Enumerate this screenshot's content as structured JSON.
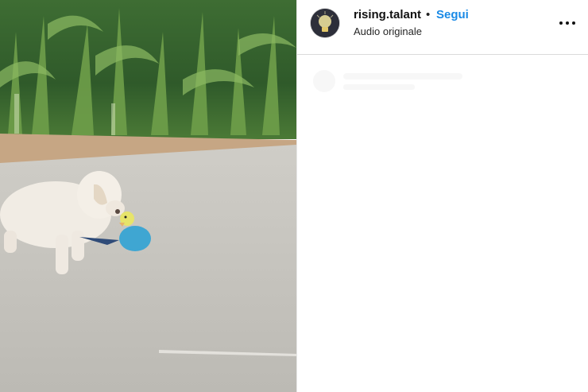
{
  "post": {
    "username": "rising.talant",
    "separator": "•",
    "follow_label": "Segui",
    "audio_label": "Audio originale"
  },
  "icons": {
    "avatar": "lightbulb-avatar",
    "more": "more-horizontal-icon"
  },
  "colors": {
    "follow": "#1a8ae6",
    "divider": "#dbdbdb"
  }
}
